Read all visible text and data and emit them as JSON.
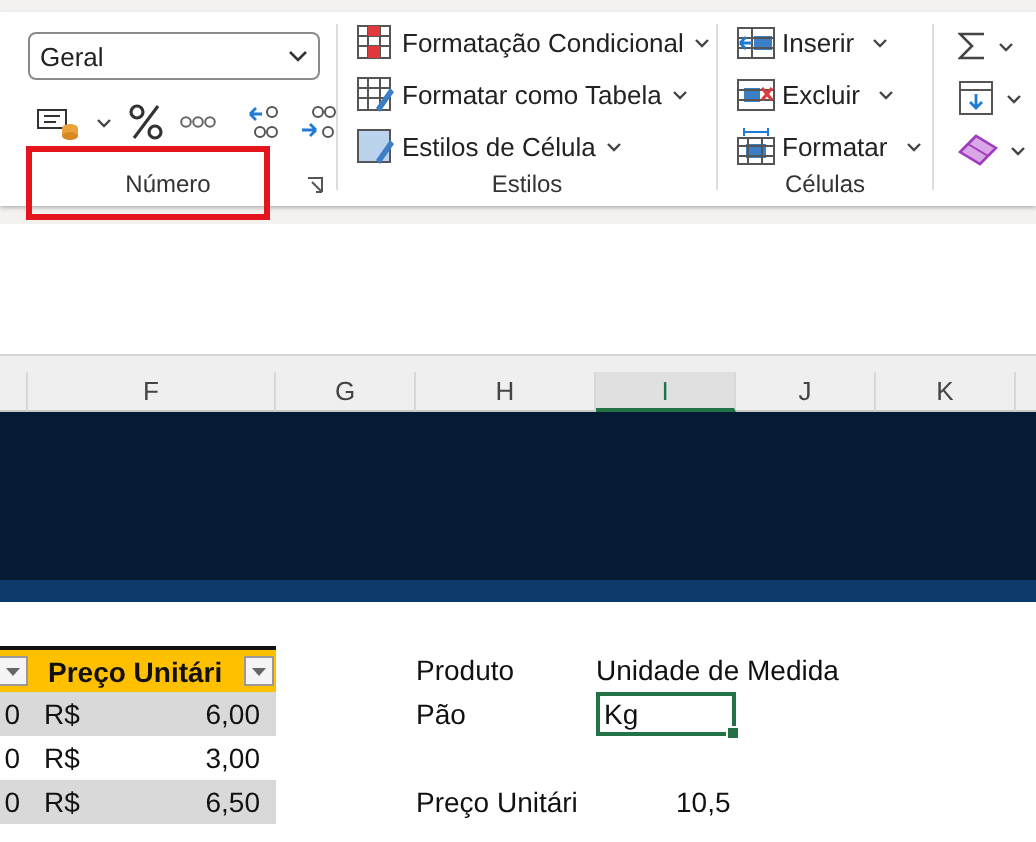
{
  "ribbon": {
    "number_group": {
      "format": "Geral",
      "label": "Número",
      "highlighted": true
    },
    "styles_group": {
      "items": [
        "Formatação Condicional",
        "Formatar como Tabela",
        "Estilos de Célula"
      ],
      "label": "Estilos"
    },
    "cells_group": {
      "items": [
        "Inserir",
        "Excluir",
        "Formatar"
      ],
      "label": "Células"
    }
  },
  "sheet": {
    "columns": [
      {
        "selected": false
      },
      {
        "label": "F",
        "selected": false
      },
      {
        "label": "G",
        "selected": false
      },
      {
        "label": "H",
        "selected": false
      },
      {
        "label": "I",
        "selected": true
      },
      {
        "label": "J",
        "selected": false
      },
      {
        "label": "K",
        "selected": false
      }
    ],
    "table": {
      "header": "Preço Unitári",
      "rows": [
        {
          "column_1": "0",
          "currency": "R$",
          "price": "6,00"
        },
        {
          "column_1": "0",
          "currency": "R$",
          "price": "3,00"
        },
        {
          "column_1": "0",
          "currency": "R$",
          "price": "6,50"
        }
      ]
    },
    "lookup": {
      "product_label": "Produto",
      "unit_label": "Unidade de Medida",
      "product": "Pão",
      "unit": {
        "text": "Kg",
        "selected": true
      },
      "price_label": "Preço Unitári",
      "price": "10,5"
    }
  }
}
